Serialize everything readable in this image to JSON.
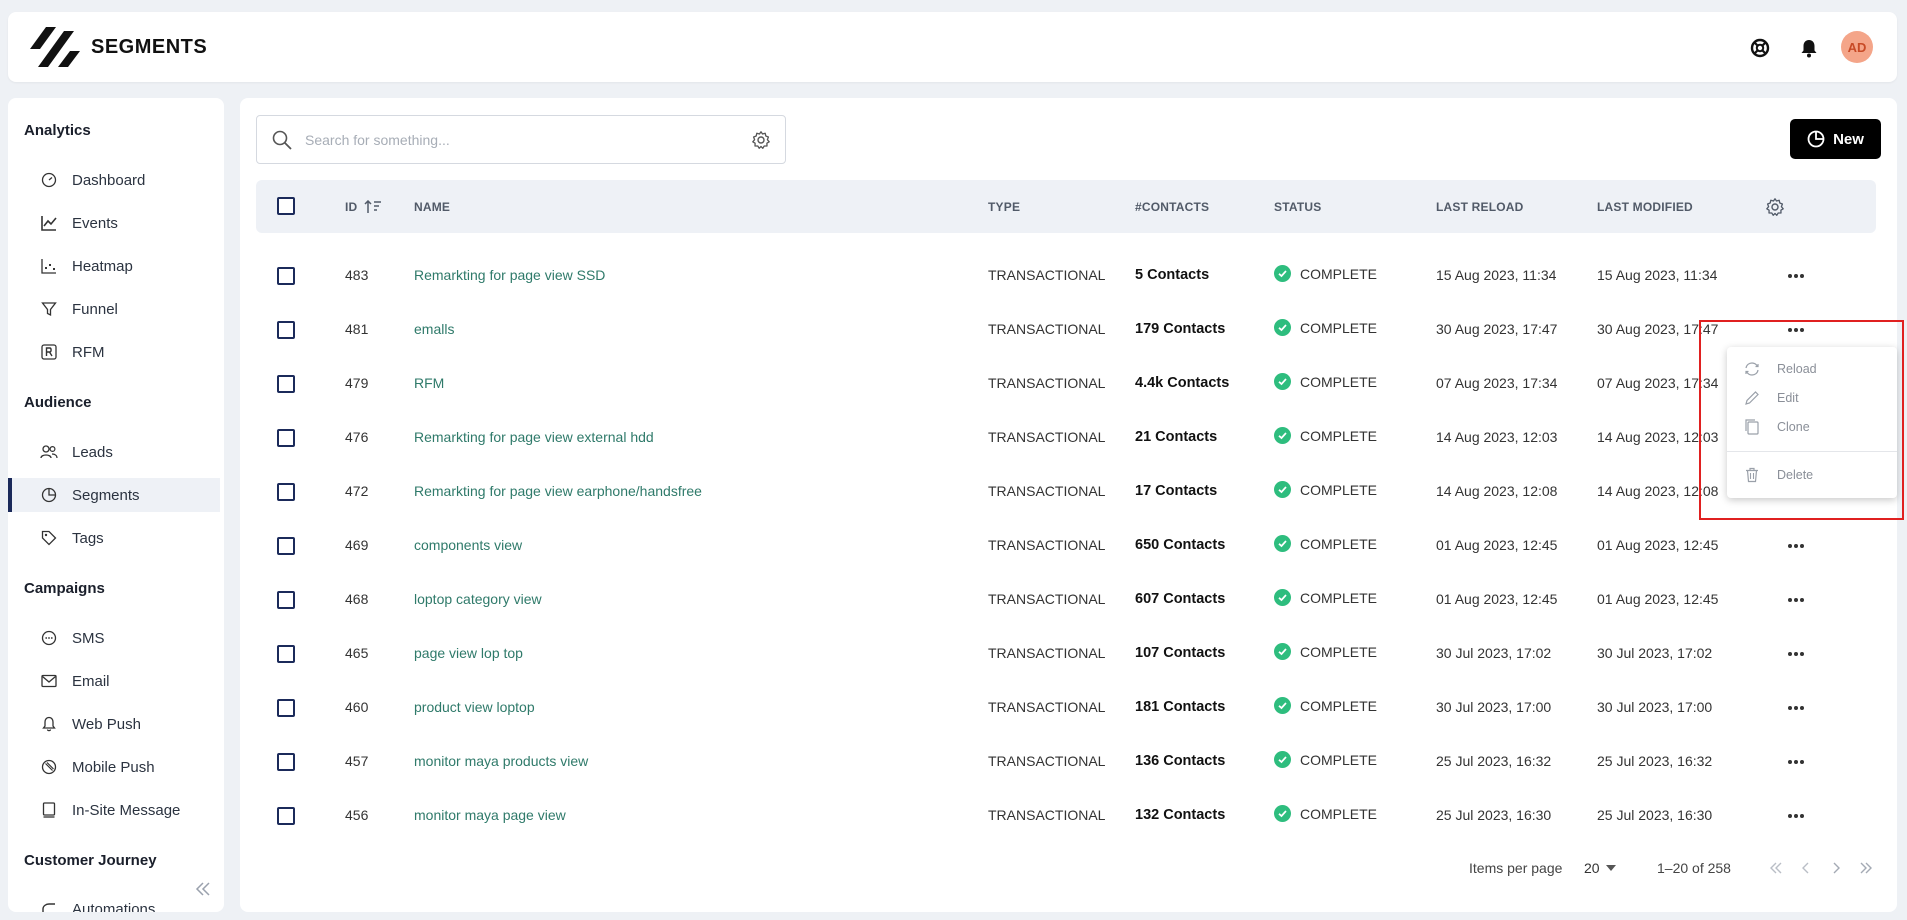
{
  "header": {
    "title": "SEGMENTS",
    "icons": [
      "help-icon",
      "bell-icon"
    ],
    "avatar_initials": "AD"
  },
  "sidebar": {
    "sections": [
      {
        "title": "Analytics",
        "items": [
          {
            "label": "Dashboard",
            "icon": "dashboard-icon"
          },
          {
            "label": "Events",
            "icon": "events-icon"
          },
          {
            "label": "Heatmap",
            "icon": "heatmap-icon"
          },
          {
            "label": "Funnel",
            "icon": "funnel-icon"
          },
          {
            "label": "RFM",
            "icon": "rfm-icon"
          }
        ]
      },
      {
        "title": "Audience",
        "items": [
          {
            "label": "Leads",
            "icon": "leads-icon"
          },
          {
            "label": "Segments",
            "icon": "segments-icon",
            "active": true
          },
          {
            "label": "Tags",
            "icon": "tags-icon"
          }
        ]
      },
      {
        "title": "Campaigns",
        "items": [
          {
            "label": "SMS",
            "icon": "sms-icon"
          },
          {
            "label": "Email",
            "icon": "email-icon"
          },
          {
            "label": "Web Push",
            "icon": "web-push-icon"
          },
          {
            "label": "Mobile Push",
            "icon": "mobile-push-icon"
          },
          {
            "label": "In-Site Message",
            "icon": "in-site-message-icon"
          }
        ]
      },
      {
        "title": "Customer Journey",
        "items": [
          {
            "label": "Automations",
            "icon": "automations-icon"
          }
        ]
      }
    ]
  },
  "search": {
    "placeholder": "Search for something...",
    "value": ""
  },
  "new_button": {
    "label": "New"
  },
  "table": {
    "columns": {
      "id": "ID",
      "name": "NAME",
      "type": "TYPE",
      "contacts": "#CONTACTS",
      "status": "STATUS",
      "last_reload": "LAST RELOAD",
      "last_modified": "LAST MODIFIED"
    },
    "rows": [
      {
        "id": "483",
        "name": "Remarkting for page view SSD",
        "type": "TRANSACTIONAL",
        "contacts": "5 Contacts",
        "status": "COMPLETE",
        "last_reload": "15 Aug 2023, 11:34",
        "last_modified": "15 Aug 2023, 11:34"
      },
      {
        "id": "481",
        "name": "emalls",
        "type": "TRANSACTIONAL",
        "contacts": "179 Contacts",
        "status": "COMPLETE",
        "last_reload": "30 Aug 2023, 17:47",
        "last_modified": "30 Aug 2023, 17:47"
      },
      {
        "id": "479",
        "name": "RFM",
        "type": "TRANSACTIONAL",
        "contacts": "4.4k Contacts",
        "status": "COMPLETE",
        "last_reload": "07 Aug 2023, 17:34",
        "last_modified": "07 Aug 2023, 17:34"
      },
      {
        "id": "476",
        "name": "Remarkting for page view external hdd",
        "type": "TRANSACTIONAL",
        "contacts": "21 Contacts",
        "status": "COMPLETE",
        "last_reload": "14 Aug 2023, 12:03",
        "last_modified": "14 Aug 2023, 12:03"
      },
      {
        "id": "472",
        "name": "Remarkting for page view earphone/handsfree",
        "type": "TRANSACTIONAL",
        "contacts": "17 Contacts",
        "status": "COMPLETE",
        "last_reload": "14 Aug 2023, 12:08",
        "last_modified": "14 Aug 2023, 12:08"
      },
      {
        "id": "469",
        "name": "components view",
        "type": "TRANSACTIONAL",
        "contacts": "650 Contacts",
        "status": "COMPLETE",
        "last_reload": "01 Aug 2023, 12:45",
        "last_modified": "01 Aug 2023, 12:45"
      },
      {
        "id": "468",
        "name": "loptop category view",
        "type": "TRANSACTIONAL",
        "contacts": "607 Contacts",
        "status": "COMPLETE",
        "last_reload": "01 Aug 2023, 12:45",
        "last_modified": "01 Aug 2023, 12:45"
      },
      {
        "id": "465",
        "name": "page view lop top",
        "type": "TRANSACTIONAL",
        "contacts": "107 Contacts",
        "status": "COMPLETE",
        "last_reload": "30 Jul 2023, 17:02",
        "last_modified": "30 Jul 2023, 17:02"
      },
      {
        "id": "460",
        "name": "product view loptop",
        "type": "TRANSACTIONAL",
        "contacts": "181 Contacts",
        "status": "COMPLETE",
        "last_reload": "30 Jul 2023, 17:00",
        "last_modified": "30 Jul 2023, 17:00"
      },
      {
        "id": "457",
        "name": "monitor maya products view",
        "type": "TRANSACTIONAL",
        "contacts": "136 Contacts",
        "status": "COMPLETE",
        "last_reload": "25 Jul 2023, 16:32",
        "last_modified": "25 Jul 2023, 16:32"
      },
      {
        "id": "456",
        "name": "monitor maya page view",
        "type": "TRANSACTIONAL",
        "contacts": "132 Contacts",
        "status": "COMPLETE",
        "last_reload": "25 Jul 2023, 16:30",
        "last_modified": "25 Jul 2023, 16:30"
      }
    ]
  },
  "context_menu": {
    "items": [
      {
        "label": "Reload",
        "icon": "reload-icon"
      },
      {
        "label": "Edit",
        "icon": "edit-icon"
      },
      {
        "label": "Clone",
        "icon": "clone-icon"
      },
      {
        "label": "Delete",
        "icon": "delete-icon"
      }
    ]
  },
  "pagination": {
    "items_per_page_label": "Items per page",
    "items_per_page": "20",
    "range": "1–20 of 258"
  },
  "colors": {
    "accent": "#1b2a5a",
    "link": "#2f7a6a",
    "status_ok": "#2ebd7e",
    "highlight": "#e02020"
  }
}
